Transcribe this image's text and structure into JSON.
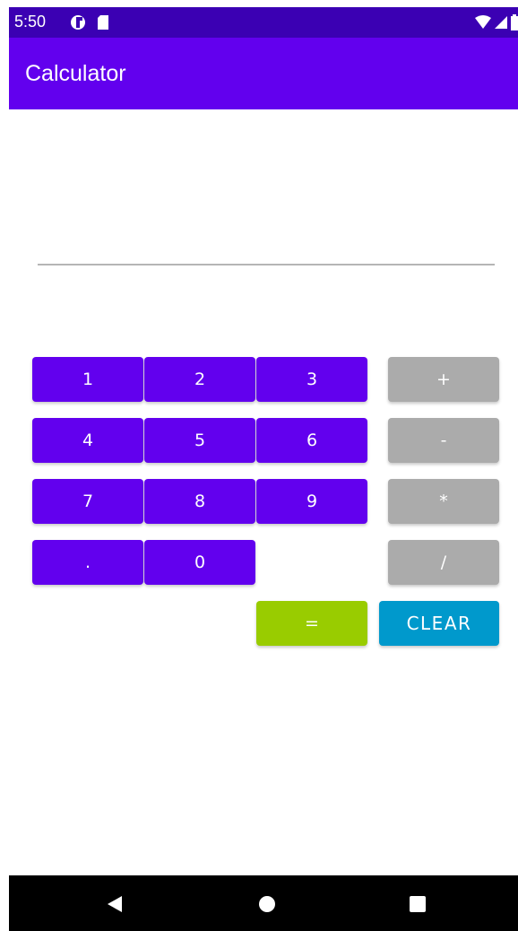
{
  "status_bar": {
    "time": "5:50",
    "left_icons": [
      "sync-circle-icon",
      "sd-card-icon"
    ],
    "right_icons": [
      "wifi-icon",
      "signal-icon",
      "battery-icon"
    ],
    "color": "#3b00b3"
  },
  "app_bar": {
    "title": "Calculator",
    "color": "#6200ee"
  },
  "display": {
    "value": "",
    "placeholder": ""
  },
  "keypad": {
    "digits": [
      "1",
      "2",
      "3",
      "4",
      "5",
      "6",
      "7",
      "8",
      "9",
      ".",
      "0"
    ],
    "operators": [
      "+",
      "-",
      "*",
      "/"
    ],
    "equals_label": "=",
    "clear_label": "CLEAR",
    "colors": {
      "digit": "#6200ee",
      "operator": "#ababab",
      "equals": "#99cc00",
      "clear": "#0099cc"
    }
  },
  "nav_bar": {
    "icons": [
      "back-icon",
      "home-icon",
      "recents-icon"
    ]
  }
}
